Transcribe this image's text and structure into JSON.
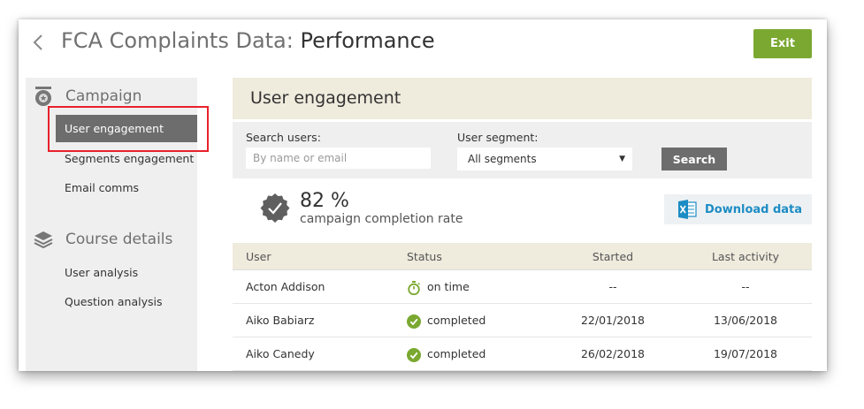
{
  "header": {
    "app_title": "FCA Complaints Data:",
    "page_title": "Performance",
    "exit_label": "Exit"
  },
  "sidebar": {
    "campaign": {
      "heading": "Campaign",
      "icon": "campaign-badge-icon",
      "items": [
        {
          "label": "User engagement",
          "active": true
        },
        {
          "label": "Segments engagement",
          "active": false
        },
        {
          "label": "Email comms",
          "active": false
        }
      ]
    },
    "course": {
      "heading": "Course details",
      "icon": "stacked-layers-icon",
      "items": [
        {
          "label": "User analysis",
          "active": false
        },
        {
          "label": "Question analysis",
          "active": false
        }
      ]
    }
  },
  "main": {
    "section_title": "User engagement",
    "filters": {
      "search_label": "Search users:",
      "search_placeholder": "By name or email",
      "search_value": "",
      "segment_label": "User segment:",
      "segment_value": "All segments",
      "search_button": "Search"
    },
    "completion": {
      "percent": "82 %",
      "label": "campaign completion rate"
    },
    "download_label": "Download data",
    "table": {
      "columns": [
        "User",
        "Status",
        "Started",
        "Last activity"
      ],
      "rows": [
        {
          "user": "Acton Addison",
          "status": "on time",
          "status_icon": "stopwatch-icon",
          "started": "--",
          "last_activity": "--"
        },
        {
          "user": "Aiko Babiarz",
          "status": "completed",
          "status_icon": "check-circle-icon",
          "started": "22/01/2018",
          "last_activity": "13/06/2018"
        },
        {
          "user": "Aiko Canedy",
          "status": "completed",
          "status_icon": "check-circle-icon",
          "started": "26/02/2018",
          "last_activity": "19/07/2018"
        }
      ]
    }
  },
  "colors": {
    "exit_green": "#7aa830",
    "status_green": "#7aa830",
    "highlight_red": "#e8212b",
    "link_blue": "#1c8cc4",
    "active_gray": "#6d6d6d",
    "header_beige": "#efebdd"
  }
}
